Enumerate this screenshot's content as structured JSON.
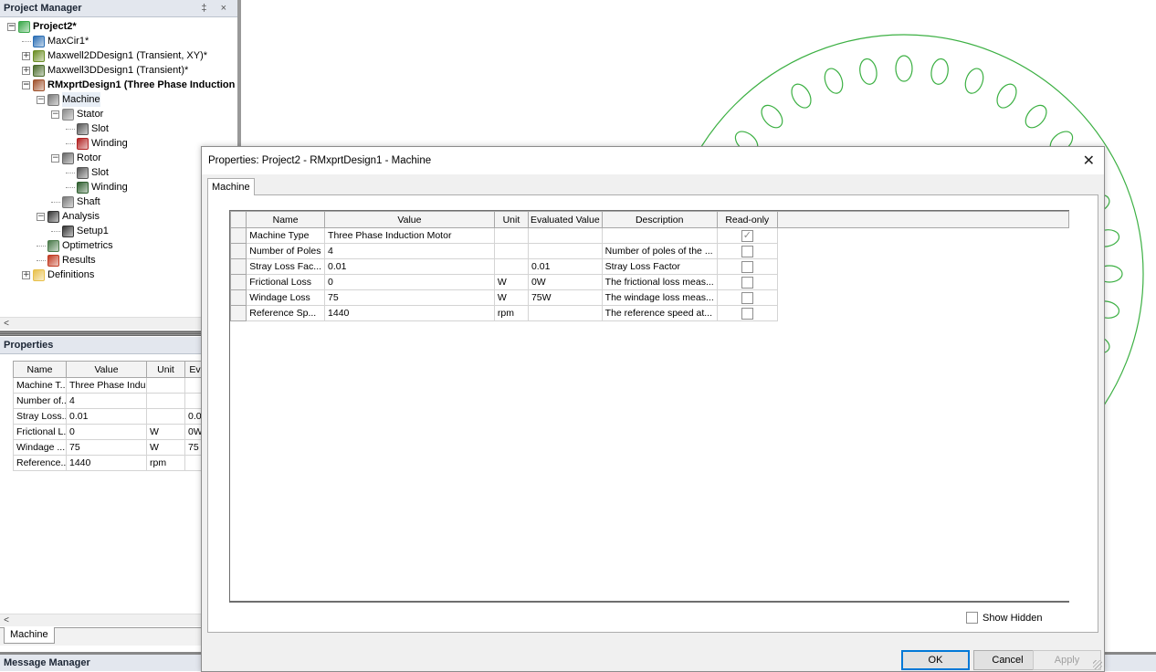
{
  "project_manager": {
    "title": "Project Manager",
    "controls": "‡ ×",
    "tree": [
      {
        "label": "Project2*",
        "depth": 0,
        "expander": "−",
        "bold": true,
        "icon": "project-icon",
        "color": "#3aa84a"
      },
      {
        "label": "MaxCir1*",
        "depth": 1,
        "expander": "",
        "bold": false,
        "icon": "circuit-icon",
        "color": "#2c6fb5"
      },
      {
        "label": "Maxwell2DDesign1 (Transient, XY)*",
        "depth": 1,
        "expander": "+",
        "bold": false,
        "icon": "maxwell2d-icon",
        "color": "#6b8e23"
      },
      {
        "label": "Maxwell3DDesign1 (Transient)*",
        "depth": 1,
        "expander": "+",
        "bold": false,
        "icon": "maxwell3d-icon",
        "color": "#4a6b2a"
      },
      {
        "label": "RMxprtDesign1 (Three Phase Induction",
        "depth": 1,
        "expander": "−",
        "bold": true,
        "icon": "rmxprt-icon",
        "color": "#a0522d"
      },
      {
        "label": "Machine",
        "depth": 2,
        "expander": "−",
        "bold": false,
        "icon": "machine-icon",
        "color": "#777",
        "selected": true
      },
      {
        "label": "Stator",
        "depth": 3,
        "expander": "−",
        "bold": false,
        "icon": "stator-icon",
        "color": "#888"
      },
      {
        "label": "Slot",
        "depth": 4,
        "expander": "",
        "bold": false,
        "icon": "slot-icon",
        "color": "#555"
      },
      {
        "label": "Winding",
        "depth": 4,
        "expander": "",
        "bold": false,
        "icon": "winding-icon",
        "color": "#b22222"
      },
      {
        "label": "Rotor",
        "depth": 3,
        "expander": "−",
        "bold": false,
        "icon": "rotor-icon",
        "color": "#666"
      },
      {
        "label": "Slot",
        "depth": 4,
        "expander": "",
        "bold": false,
        "icon": "slot-icon",
        "color": "#555"
      },
      {
        "label": "Winding",
        "depth": 4,
        "expander": "",
        "bold": false,
        "icon": "rotor-winding-icon",
        "color": "#2e5e2e"
      },
      {
        "label": "Shaft",
        "depth": 3,
        "expander": "",
        "bold": false,
        "icon": "shaft-icon",
        "color": "#777"
      },
      {
        "label": "Analysis",
        "depth": 2,
        "expander": "−",
        "bold": false,
        "icon": "analysis-icon",
        "color": "#333"
      },
      {
        "label": "Setup1",
        "depth": 3,
        "expander": "",
        "bold": false,
        "icon": "setup-icon",
        "color": "#333"
      },
      {
        "label": "Optimetrics",
        "depth": 2,
        "expander": "",
        "bold": false,
        "icon": "optimetrics-icon",
        "color": "#4a7a4a"
      },
      {
        "label": "Results",
        "depth": 2,
        "expander": "",
        "bold": false,
        "icon": "results-icon",
        "color": "#c23b22"
      },
      {
        "label": "Definitions",
        "depth": 1,
        "expander": "+",
        "bold": false,
        "icon": "folder-icon",
        "color": "#e8c04a"
      }
    ]
  },
  "properties_panel": {
    "title": "Properties",
    "columns": [
      "Name",
      "Value",
      "Unit",
      "Ev"
    ],
    "rows": [
      [
        "Machine T...",
        "Three Phase Indu...",
        "",
        ""
      ],
      [
        "Number of...",
        "4",
        "",
        ""
      ],
      [
        "Stray Loss...",
        "0.01",
        "",
        "0.0"
      ],
      [
        "Frictional L...",
        "0",
        "W",
        "0W"
      ],
      [
        "Windage ...",
        "75",
        "W",
        "75"
      ],
      [
        "Reference...",
        "1440",
        "rpm",
        ""
      ]
    ],
    "tab_label": "Machine"
  },
  "message_manager": {
    "title": "Message Manager"
  },
  "dialog": {
    "title": "Properties: Project2 - RMxprtDesign1 - Machine",
    "close_glyph": "✕",
    "tab_label": "Machine",
    "columns": [
      "Name",
      "Value",
      "Unit",
      "Evaluated Value",
      "Description",
      "Read-only"
    ],
    "rows": [
      {
        "name": "Machine Type",
        "value": "Three Phase Induction Motor",
        "unit": "",
        "evaluated": "",
        "description": "",
        "readonly": true
      },
      {
        "name": "Number of Poles",
        "value": "4",
        "unit": "",
        "evaluated": "",
        "description": "Number of poles of the ...",
        "readonly": false
      },
      {
        "name": "Stray Loss Fac...",
        "value": "0.01",
        "unit": "",
        "evaluated": "0.01",
        "description": "Stray Loss Factor",
        "readonly": false
      },
      {
        "name": "Frictional Loss",
        "value": "0",
        "unit": "W",
        "evaluated": "0W",
        "description": "The frictional loss meas...",
        "readonly": false
      },
      {
        "name": "Windage Loss",
        "value": "75",
        "unit": "W",
        "evaluated": "75W",
        "description": "The windage loss meas...",
        "readonly": false
      },
      {
        "name": "Reference Sp...",
        "value": "1440",
        "unit": "rpm",
        "evaluated": "",
        "description": "The reference speed at...",
        "readonly": false
      }
    ],
    "show_hidden_label": "Show Hidden",
    "ok_label": "OK",
    "cancel_label": "Cancel",
    "apply_label": "Apply"
  },
  "scroll_left_glyph": "<",
  "colors": {
    "motor_outline": "#3cb043",
    "panel_header": "#e3e7ee",
    "default_button": "#0078d7"
  }
}
